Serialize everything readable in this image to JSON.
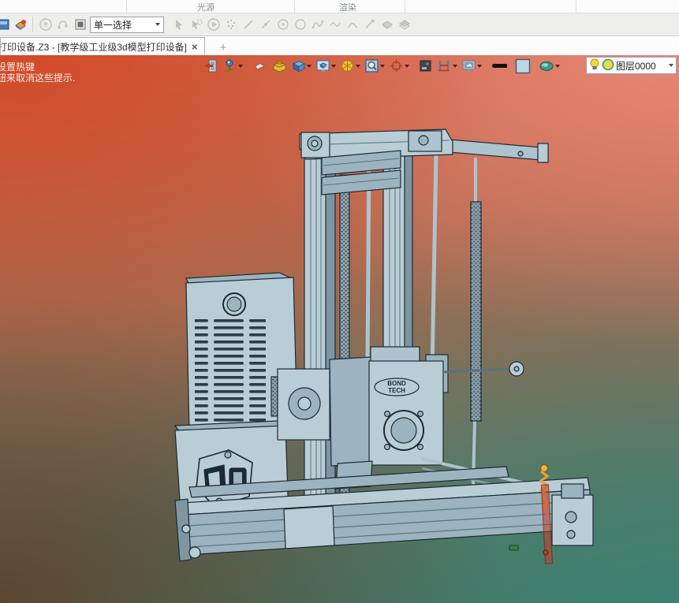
{
  "ribbon": {
    "groups": [
      "光源",
      "渲染"
    ]
  },
  "selection_toolbar": {
    "selection_mode_value": "单一选择",
    "icons": [
      "window-manager-icon",
      "viewport-style-icon",
      "orbit-select-icon",
      "chain-select-icon",
      "region-select-icon",
      "cursor-icon",
      "smart-pick-icon",
      "play-icon",
      "point-cloud-icon",
      "line-icon",
      "polyline-icon",
      "circle-center-icon",
      "circle-icon",
      "spline-icon",
      "wave-icon",
      "arc-icon",
      "pen-icon",
      "iso-box-icon",
      "iso-box-alt-icon"
    ]
  },
  "tab_bar": {
    "active_tab_label": "打印设备.Z3 - [教学级工业级3d模型打印设备]",
    "close_glyph": "×",
    "new_tab_glyph": "+"
  },
  "render_toolbar": {
    "icons": [
      "exit-render-icon",
      "pin-display-icon",
      "brush-icon",
      "toolbox-icon",
      "cube-icon",
      "display-cube-icon",
      "color-wheel-icon",
      "zoom-region-icon",
      "target-icon",
      "frame-icon",
      "clip-plane-icon",
      "screen-cloud-icon",
      "line-weight-swatch",
      "color-swatch",
      "material-disc-icon"
    ]
  },
  "layer_combo": {
    "bulb_icon": "layer-visibility-bulb-icon",
    "color_icon": "layer-color-circle-icon",
    "value": "图层0000"
  },
  "viewport": {
    "hints": [
      "设置热键",
      "钮来取消这些提示."
    ],
    "model_badge_line1": "BOND",
    "model_badge_line2": "TECH"
  },
  "colors": {
    "viewport_top_left": "#d24826",
    "viewport_top_right": "#e88776",
    "viewport_bottom_left": "#5d442e",
    "viewport_bottom_right": "#3e8172",
    "model_light": "#b9cdd6",
    "model_mid": "#9cb4bf",
    "model_dark": "#7d96a2",
    "model_outline": "#1c2b33",
    "spring_yellow": "#e8a13c",
    "rod_red": "#c23c2a"
  }
}
